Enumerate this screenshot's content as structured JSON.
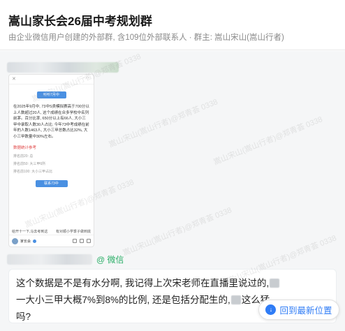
{
  "header": {
    "title": "嵩山家长会26届中考规划群",
    "subtitle": "由企业微信用户创建的外部群, 含109位外部联系人 · 群主: 嵩山宋山(嵩山行者)"
  },
  "message1": {
    "image_card": {
      "top_button": "听听7月中",
      "body_text": "在2025年9月中, 73中S类模拟赛高于700分以上人数超过20人, 这个成绩在众多学校中名列前茅。百分比率, 650分以上有66人, 大小三甲中录取人数30人占比; 今年73中考成绩在前年的人数1463人, 大小三甲总数占比32%, 大小三甲数量中30%左右。",
      "red_heading": "数据统计参考",
      "list_items": [
        "排名前20: 总",
        "排名前50: 大三甲6所",
        "排名前100: 大小三甲占比"
      ],
      "bottom_button": "联系73中",
      "bottom_left": "给开十一下,马去考到这",
      "bottom_right": "有对顺小学季子做到底",
      "footer_name": "家长会",
      "icons": [
        "share-icon",
        "comment-icon",
        "like-icon"
      ]
    }
  },
  "message2": {
    "source_tag": "@ 微信",
    "line1": "这个数据是不是有水分啊, 我记得上次宋老师在直播里说过的,",
    "line2_a": "一大小三甲大概7%到8%的比例, 还是包括分配生的,",
    "line2_b": "这么猛",
    "line3": "吗?"
  },
  "jump_button": {
    "icon": "arrow-down-icon",
    "label": "回到最新位置"
  },
  "colors": {
    "accent": "#2f7cf6",
    "wechat_green": "#2aae67",
    "chat_bg": "#f5f6f7"
  }
}
